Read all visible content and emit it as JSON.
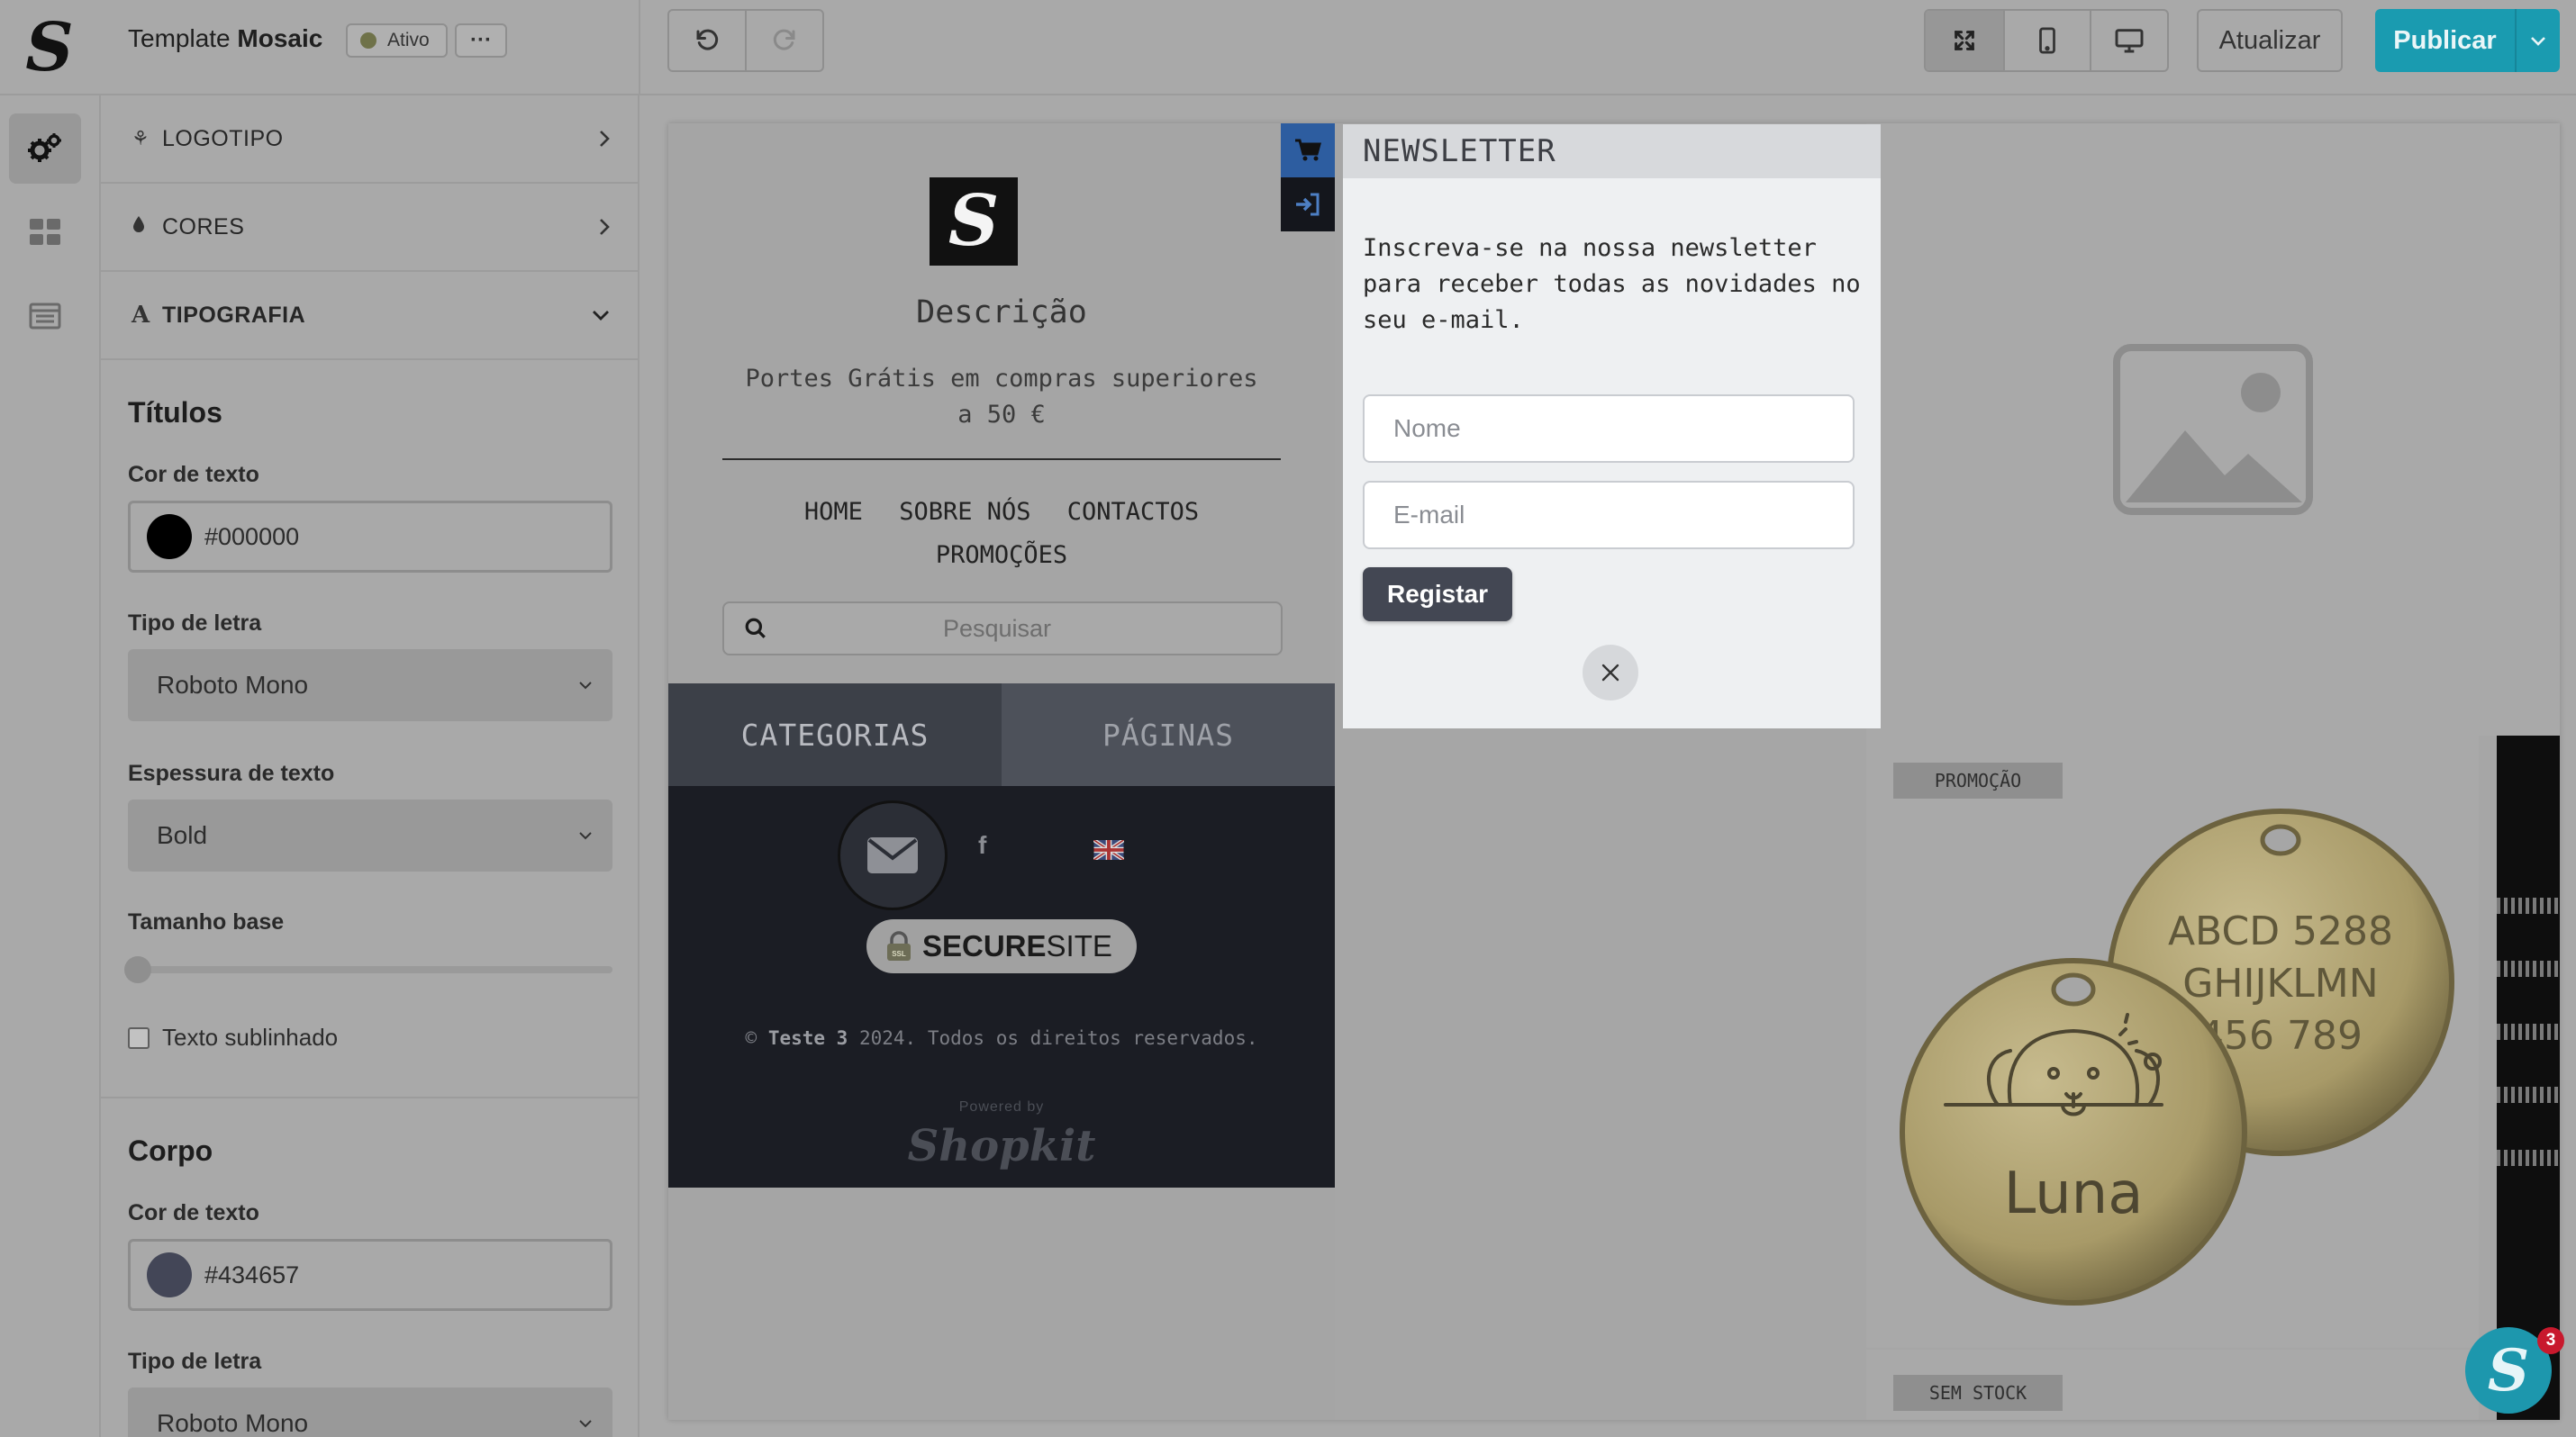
{
  "app": {
    "title_prefix": "Template",
    "title_name": "Mosaic",
    "status": "Ativo",
    "more": "···"
  },
  "toolbar": {
    "update_label": "Atualizar",
    "publish_label": "Publicar"
  },
  "panel": {
    "accordion": [
      {
        "label": "LOGOTIPO",
        "icon": "logo-icon"
      },
      {
        "label": "CORES",
        "icon": "droplet-icon"
      },
      {
        "label": "TIPOGRAFIA",
        "icon": "typography-icon"
      }
    ],
    "titles": {
      "heading": "Títulos",
      "text_color_label": "Cor de texto",
      "text_color_value": "#000000",
      "font_label": "Tipo de letra",
      "font_value": "Roboto Mono",
      "weight_label": "Espessura de texto",
      "weight_value": "Bold",
      "size_label": "Tamanho base",
      "size_level": 0,
      "underline_label": "Texto sublinhado",
      "underline_checked": false
    },
    "body": {
      "heading": "Corpo",
      "text_color_label": "Cor de texto",
      "text_color_value": "#434657",
      "font_label": "Tipo de letra",
      "font_value": "Roboto Mono"
    }
  },
  "store": {
    "description": "Descrição",
    "shipping": "Portes Grátis em compras superiores a 50 €",
    "nav": [
      "HOME",
      "SOBRE NÓS",
      "CONTACTOS",
      "PROMOÇÕES"
    ],
    "search_placeholder": "Pesquisar",
    "tabs": [
      "CATEGORIAS",
      "PÁGINAS"
    ],
    "secure_bold": "SECURE",
    "secure_rest": "SITE",
    "copyright_prefix": "©",
    "copyright_name": "Teste 3",
    "copyright_rest": "2024. Todos os direitos reservados.",
    "powered_by": "Powered by",
    "powered_brand": "Shopkit"
  },
  "products": {
    "promo_badge": "PROMOÇÃO",
    "nostock_badge": "SEM STOCK",
    "tag_back_lines": [
      "ABCD 5288",
      "GHIJKLMN",
      "456 789"
    ],
    "tag_front_name": "Luna"
  },
  "newsletter": {
    "title": "NEWSLETTER",
    "text": "Inscreva-se na nossa newsletter para receber todas as novidades no seu e-mail.",
    "name_placeholder": "Nome",
    "email_placeholder": "E-mail",
    "submit": "Registar"
  },
  "chat": {
    "badge": "3"
  },
  "colors": {
    "publish": "#1a9bb0",
    "cart_tab": "#2d5da0",
    "footer_bg": "#1b1d24",
    "title_color": "#000000",
    "body_color": "#434657"
  }
}
